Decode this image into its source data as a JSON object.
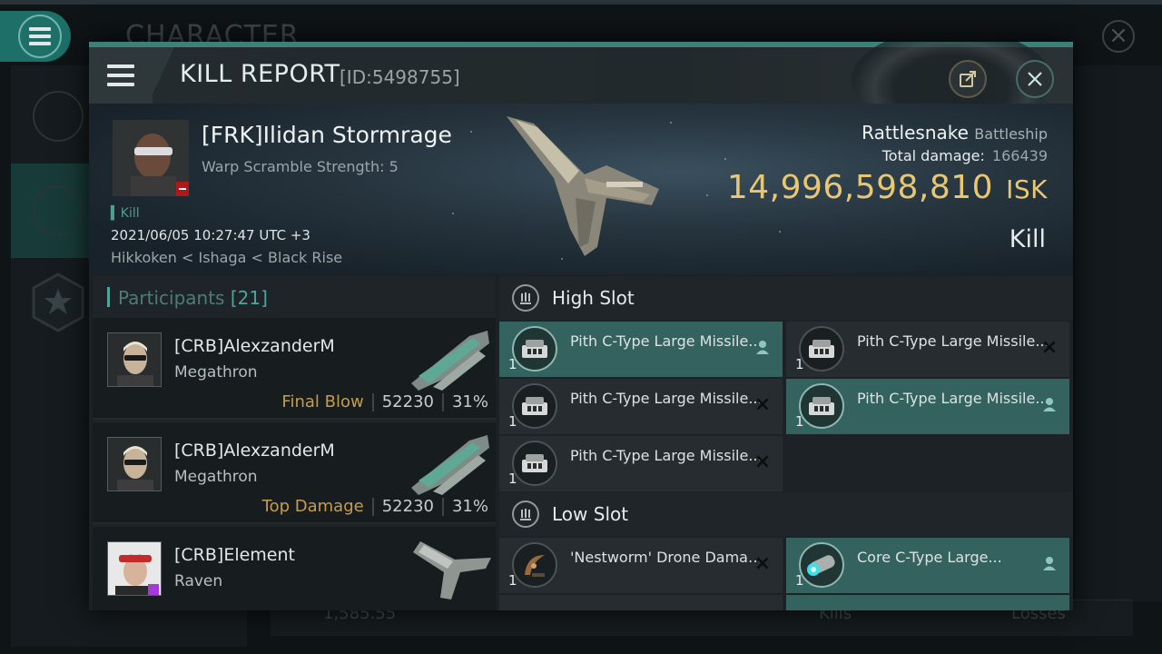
{
  "background": {
    "screen_title": "CHARACTER",
    "bottom_value": "1,585.55",
    "bottom_kills": "Kills",
    "bottom_losses": "Losses"
  },
  "header": {
    "title": "KILL REPORT",
    "id_label": "[ID:5498755]",
    "menu_icon": "hamburger-icon",
    "share_icon": "share-icon",
    "close_icon": "close-icon"
  },
  "victim": {
    "name": "[FRK]Ilidan Stormrage",
    "warp_scramble": "Warp Scramble Strength: 5",
    "tag": "Kill",
    "datetime": "2021/06/05 10:27:47 UTC +3",
    "location": "Hikkoken < Ishaga < Black Rise",
    "ship": "Rattlesnake",
    "ship_class": "Battleship",
    "total_damage_label": "Total damage:",
    "total_damage": "166439",
    "isk_value": "14,996,598,810",
    "isk_unit": "ISK",
    "result": "Kill"
  },
  "participants": {
    "label": "Participants",
    "count": "[21]",
    "rows": [
      {
        "name": "[CRB]AlexzanderM",
        "ship": "Megathron",
        "tag": "Final Blow",
        "damage": "52230",
        "percent": "31%"
      },
      {
        "name": "[CRB]AlexzanderM",
        "ship": "Megathron",
        "tag": "Top Damage",
        "damage": "52230",
        "percent": "31%"
      },
      {
        "name": "[CRB]Element",
        "ship": "Raven",
        "tag": "",
        "damage": "",
        "percent": ""
      }
    ]
  },
  "fittings": {
    "high_slot_label": "High Slot",
    "low_slot_label": "Low Slot",
    "high": [
      {
        "name": "Pith C-Type Large Missile...",
        "qty": "1",
        "state": "person"
      },
      {
        "name": "Pith C-Type Large Missile...",
        "qty": "1",
        "state": "x"
      },
      {
        "name": "Pith C-Type Large Missile...",
        "qty": "1",
        "state": "x"
      },
      {
        "name": "Pith C-Type Large Missile...",
        "qty": "1",
        "state": "person"
      },
      {
        "name": "Pith C-Type Large Missile...",
        "qty": "1",
        "state": "x"
      }
    ],
    "low": [
      {
        "name": "'Nestworm' Drone Damage ...",
        "qty": "1",
        "state": "x"
      },
      {
        "name": "Core C-Type Large...",
        "qty": "1",
        "state": "person"
      }
    ]
  },
  "colors": {
    "accent": "#3d7f79",
    "highlight_row": "#34635f",
    "isk": "#e7c774",
    "final_blow": "#c69d4e"
  }
}
